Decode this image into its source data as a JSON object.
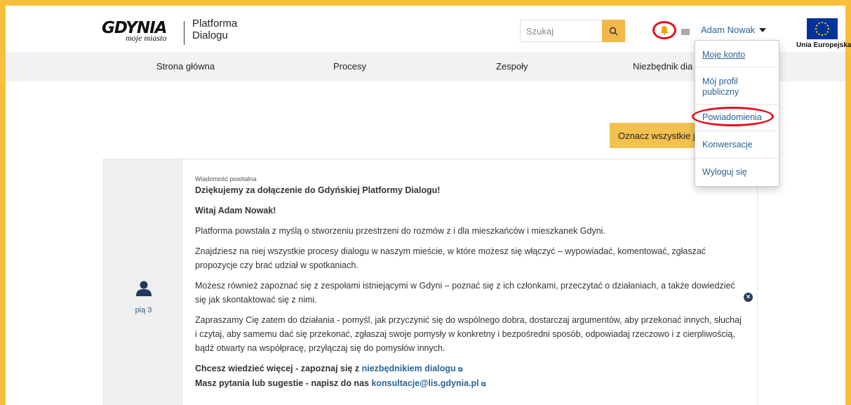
{
  "header": {
    "logo": {
      "main": "GDYNIA",
      "sub": "moje miasto"
    },
    "platform_name": "Platforma Dialogu",
    "search": {
      "placeholder": "Szukaj",
      "value": ""
    },
    "user_name": "Adam Nowak",
    "eu_label": "Unia Europejska"
  },
  "colors": {
    "accent": "#f2c14e",
    "frame": "#f9bf3b",
    "link": "#2a6496",
    "highlight": "#e3101a"
  },
  "icons": {
    "search": "search-icon",
    "bell": "bell-icon",
    "mail": "envelope-icon",
    "caret": "caret-down-icon",
    "avatar": "user-icon",
    "close": "close-circle-icon",
    "external": "external-link-icon"
  },
  "nav": {
    "items": [
      "Strona główna",
      "Procesy",
      "Zespoły",
      "Niezbędnik dia"
    ]
  },
  "user_dropdown": {
    "items": [
      "Moje konto",
      "Mój profil publiczny",
      "Powiadomienia",
      "Konwersacje",
      "Wyloguj się"
    ]
  },
  "actions": {
    "mark_all": "Oznacz wszystkie jak"
  },
  "message": {
    "date": "pią 3",
    "tag": "Wiadomość powitalna",
    "title": "Dziękujemy za dołączenie do Gdyńskiej Platformy Dialogu!",
    "greeting": "Witaj Adam Nowak!",
    "paragraphs": [
      "Platforma powstała z myślą o stworzeniu przestrzeni do rozmów z i dla mieszkańców i mieszkanek Gdyni.",
      "Znajdziesz na niej wszystkie procesy dialogu w naszym mieście, w które możesz się włączyć – wypowiadać, komentować, zgłaszać propozycje czy brać udział w spotkaniach.",
      "Możesz również zapoznać się z zespołami istniejącymi w Gdyni – poznać się z ich członkami, przeczytać o działaniach, a także dowiedzieć się jak skontaktować się z nimi.",
      "Zapraszamy Cię zatem do działania - pomyśl, jak przyczynić się do wspólnego dobra, dostarczaj argumentów, aby przekonać innych, słuchaj i czytaj, aby samemu dać się przekonać, zgłaszaj swoje pomysły w konkretny i bezpośredni sposób, odpowiadaj rzeczowo i z cierpliwością, bądź otwarty na współpracę, przyłączaj się do pomysłów innych."
    ],
    "more_prefix": "Chcesz wiedzieć więcej - zapoznaj się z",
    "more_link": "niezbędnikiem dialogu",
    "contact_prefix": "Masz pytania lub sugestie - napisz do nas",
    "contact_link": "konsultacje@lis.gdynia.pl"
  }
}
